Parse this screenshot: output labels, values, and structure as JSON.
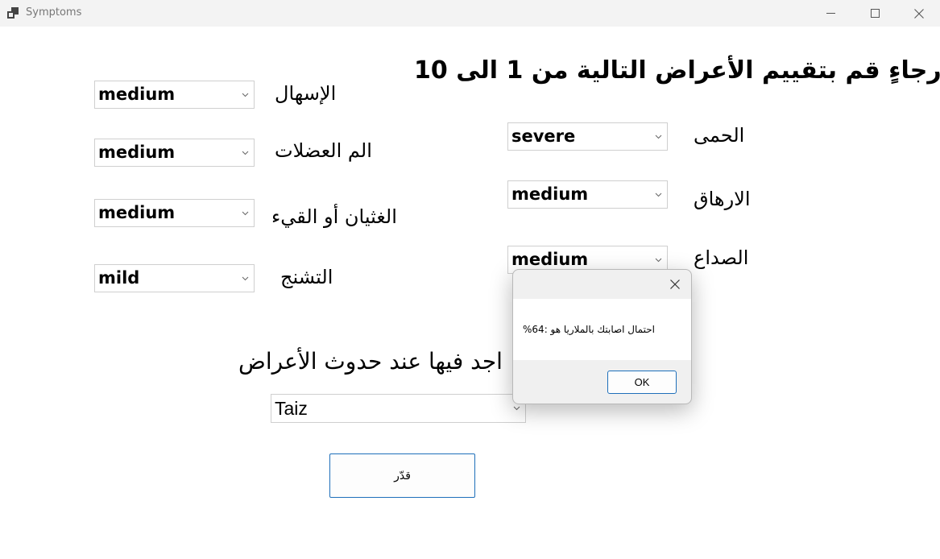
{
  "window": {
    "title": "Symptoms",
    "icon": "app-window-icon",
    "controls": [
      "minimize-icon",
      "maximize-icon",
      "close-icon"
    ]
  },
  "heading_rate": "رجاءٍ قم بتقييم الأعراض التالية من 1 الى 10",
  "symptoms": [
    {
      "label": "الإسهال",
      "value": "medium"
    },
    {
      "label": "الم العضلات",
      "value": "medium"
    },
    {
      "label": "الغثيان أو القيء",
      "value": "medium"
    },
    {
      "label": "التشنج",
      "value": "mild"
    },
    {
      "label": "الحمى",
      "value": "severe"
    },
    {
      "label": "الارهاق",
      "value": "medium"
    },
    {
      "label": "الصداع",
      "value": "medium"
    }
  ],
  "heading_location": "اجد فيها عند حدوث الأعراض",
  "city": {
    "value": "Taiz"
  },
  "estimate_button": "قدّر",
  "dialog": {
    "message": "%احتمال اصابتك بالملاريا هو :64",
    "ok_label": "OK"
  },
  "colors": {
    "accent": "#1e6fba",
    "titlebar": "#f3f3f3",
    "dialog_footer": "#f0f0f0"
  }
}
